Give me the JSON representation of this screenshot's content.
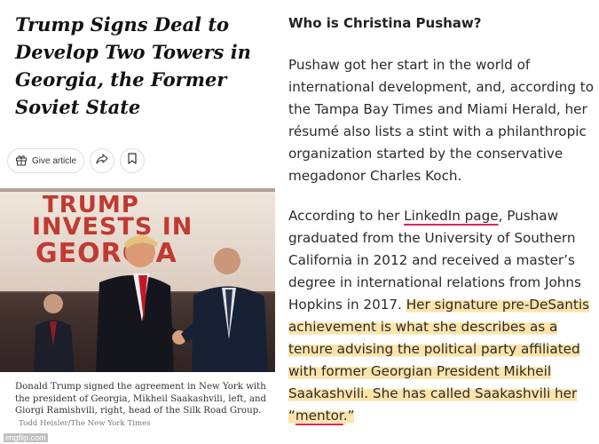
{
  "article": {
    "headline": "Trump Signs Deal to Develop Two Towers in Georgia, the Former Soviet State",
    "give_article_label": "Give article",
    "icons": {
      "give": "gift-icon",
      "share": "share-arrow-icon",
      "save": "bookmark-icon"
    },
    "photo": {
      "banner_line1": "TRUMP",
      "banner_line2": "INVESTS IN",
      "banner_line3": "GEORGIA"
    },
    "caption": "Donald Trump signed the agreement in New York with the president of Georgia, Mikheil Saakashvili, left, and Giorgi Ramishvili, right, head of the Silk Road Group.",
    "credit": "Todd Heisler/The New York Times"
  },
  "watermark": "imgflip.com",
  "profile": {
    "question": "Who is Christina Pushaw?",
    "p1": "Pushaw got her start in the world of international development, and, according to the Tampa Bay Times and Miami Herald, her résumé also lists a stint with a philanthropic organization started by the conservative megadonor Charles Koch.",
    "p2_start": "According to her ",
    "p2_link": "LinkedIn page",
    "p2_mid": ", Pushaw graduated from the University of Southern California in 2012 and received a master’s degree in international relations from Johns Hopkins in 2017. ",
    "p2_highlight": "Her signature pre-DeSantis achievement is what she describes as a tenure advising the political party affiliated with former Georgian President Mikheil Saakashvili. She has called Saakashvili her “",
    "p2_mentor": "mentor",
    "p2_end": ".”"
  },
  "colors": {
    "highlight": "#fbde9b",
    "link_underline": "#e0245e",
    "banner_red": "#c03a32"
  }
}
